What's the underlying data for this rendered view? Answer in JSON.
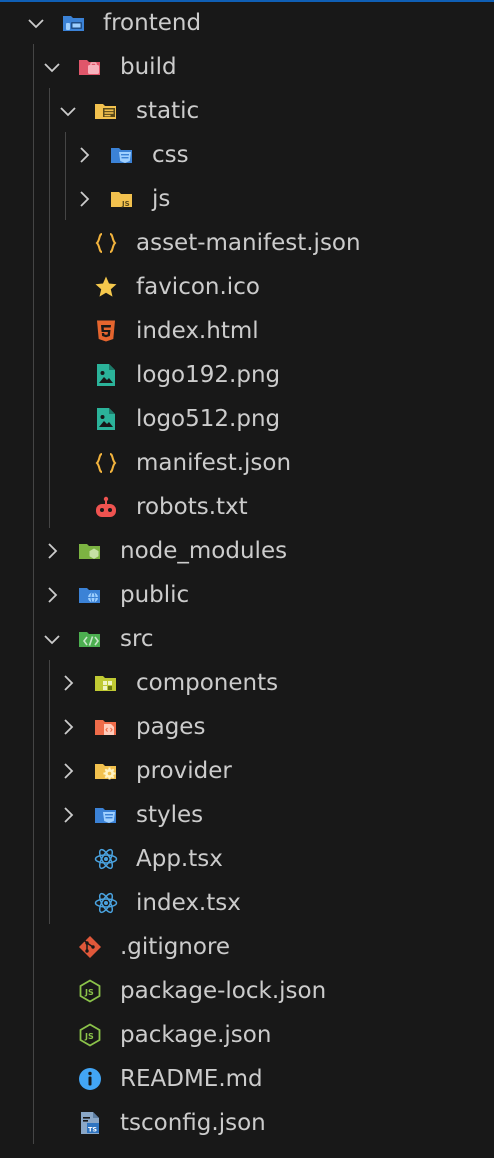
{
  "explorer": {
    "rows": [
      {
        "label": "frontend",
        "icon": "devices-folder-icon",
        "chevron": "expanded"
      },
      {
        "label": "build",
        "icon": "build-folder-icon",
        "chevron": "expanded"
      },
      {
        "label": "static",
        "icon": "static-folder-icon",
        "chevron": "expanded"
      },
      {
        "label": "css",
        "icon": "css-folder-icon",
        "chevron": "collapsed"
      },
      {
        "label": "js",
        "icon": "js-folder-icon",
        "chevron": "collapsed"
      },
      {
        "label": "asset-manifest.json",
        "icon": "json-braces-icon"
      },
      {
        "label": "favicon.ico",
        "icon": "star-icon"
      },
      {
        "label": "index.html",
        "icon": "html5-icon"
      },
      {
        "label": "logo192.png",
        "icon": "image-file-icon"
      },
      {
        "label": "logo512.png",
        "icon": "image-file-icon"
      },
      {
        "label": "manifest.json",
        "icon": "json-braces-icon"
      },
      {
        "label": "robots.txt",
        "icon": "robot-icon"
      },
      {
        "label": "node_modules",
        "icon": "node-folder-icon",
        "chevron": "collapsed"
      },
      {
        "label": "public",
        "icon": "globe-folder-icon",
        "chevron": "collapsed"
      },
      {
        "label": "src",
        "icon": "code-folder-icon",
        "chevron": "expanded"
      },
      {
        "label": "components",
        "icon": "components-folder-icon",
        "chevron": "collapsed"
      },
      {
        "label": "pages",
        "icon": "pages-folder-icon",
        "chevron": "collapsed"
      },
      {
        "label": "provider",
        "icon": "gear-folder-icon",
        "chevron": "collapsed"
      },
      {
        "label": "styles",
        "icon": "css-folder-icon",
        "chevron": "collapsed"
      },
      {
        "label": "App.tsx",
        "icon": "react-icon"
      },
      {
        "label": "index.tsx",
        "icon": "react-icon"
      },
      {
        "label": ".gitignore",
        "icon": "git-icon"
      },
      {
        "label": "package-lock.json",
        "icon": "nodejs-icon"
      },
      {
        "label": "package.json",
        "icon": "nodejs-icon"
      },
      {
        "label": "README.md",
        "icon": "info-icon"
      },
      {
        "label": "tsconfig.json",
        "icon": "tsconfig-icon"
      }
    ]
  },
  "colors": {
    "background": "#181818",
    "text": "#cccccc",
    "guide": "#454545",
    "accent": "#0f5fb5"
  }
}
